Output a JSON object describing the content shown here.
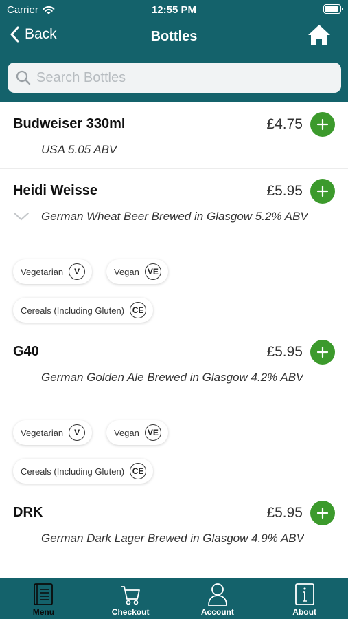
{
  "status_bar": {
    "carrier": "Carrier",
    "time": "12:55 PM",
    "battery_level": 0.9
  },
  "nav": {
    "back_label": "Back",
    "title": "Bottles",
    "home_icon": "home-icon"
  },
  "search": {
    "placeholder": "Search Bottles",
    "value": ""
  },
  "items": [
    {
      "name": "Budweiser 330ml",
      "price": "£4.75",
      "description": "USA 5.05 ABV",
      "tags": []
    },
    {
      "name": "Heidi Weisse",
      "price": "£5.95",
      "description": "German Wheat Beer Brewed in Glasgow 5.2% ABV",
      "tags": [
        {
          "label": "Vegetarian",
          "code": "V"
        },
        {
          "label": "Vegan",
          "code": "VE"
        },
        {
          "label": "Cereals (Including Gluten)",
          "code": "CE"
        }
      ]
    },
    {
      "name": "G40",
      "price": "£5.95",
      "description": "German Golden Ale Brewed in Glasgow 4.2% ABV",
      "tags": [
        {
          "label": "Vegetarian",
          "code": "V"
        },
        {
          "label": "Vegan",
          "code": "VE"
        },
        {
          "label": "Cereals (Including Gluten)",
          "code": "CE"
        }
      ]
    },
    {
      "name": "DRK",
      "price": "£5.95",
      "description": "German Dark Lager Brewed in Glasgow 4.9% ABV",
      "tags": []
    }
  ],
  "tabbar": {
    "active": "Menu",
    "tabs": [
      {
        "label": "Menu",
        "icon": "menu-book-icon"
      },
      {
        "label": "Checkout",
        "icon": "cart-icon"
      },
      {
        "label": "Account",
        "icon": "user-icon"
      },
      {
        "label": "About",
        "icon": "info-icon"
      }
    ]
  },
  "colors": {
    "header": "#14626b",
    "add_button": "#3c9a2c"
  }
}
